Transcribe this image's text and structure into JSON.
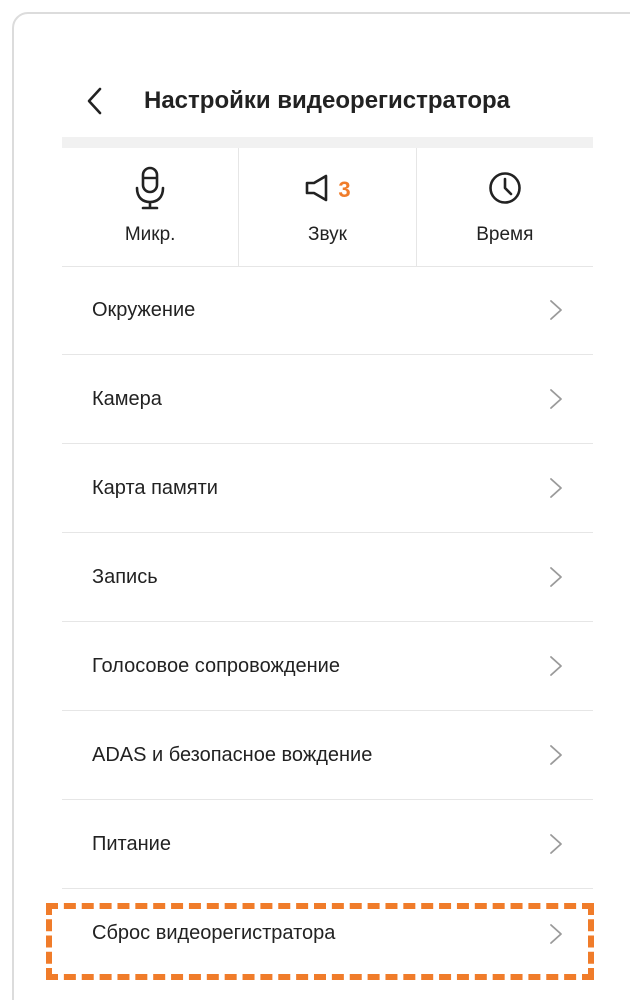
{
  "header": {
    "title": "Настройки видеорегистратора",
    "back_icon": "chevron-left-icon"
  },
  "quick_actions": [
    {
      "label": "Микр.",
      "icon": "microphone-icon"
    },
    {
      "label": "Звук",
      "icon": "speaker-icon",
      "count": "3"
    },
    {
      "label": "Время",
      "icon": "clock-icon"
    }
  ],
  "menu": {
    "items": [
      {
        "label": "Окружение"
      },
      {
        "label": "Камера"
      },
      {
        "label": "Карта памяти"
      },
      {
        "label": "Запись"
      },
      {
        "label": "Голосовое сопровождение"
      },
      {
        "label": "ADAS и безопасное вождение"
      },
      {
        "label": "Питание"
      },
      {
        "label": "Сброс видеорегистратора"
      }
    ],
    "chevron_icon": "chevron-right-icon",
    "highlighted_item": "Сброс видеорегистратора"
  },
  "colors": {
    "accent": "#f07c2a",
    "text": "#222222",
    "divider": "#e6e6e6",
    "chevron": "#9a9a9a"
  }
}
